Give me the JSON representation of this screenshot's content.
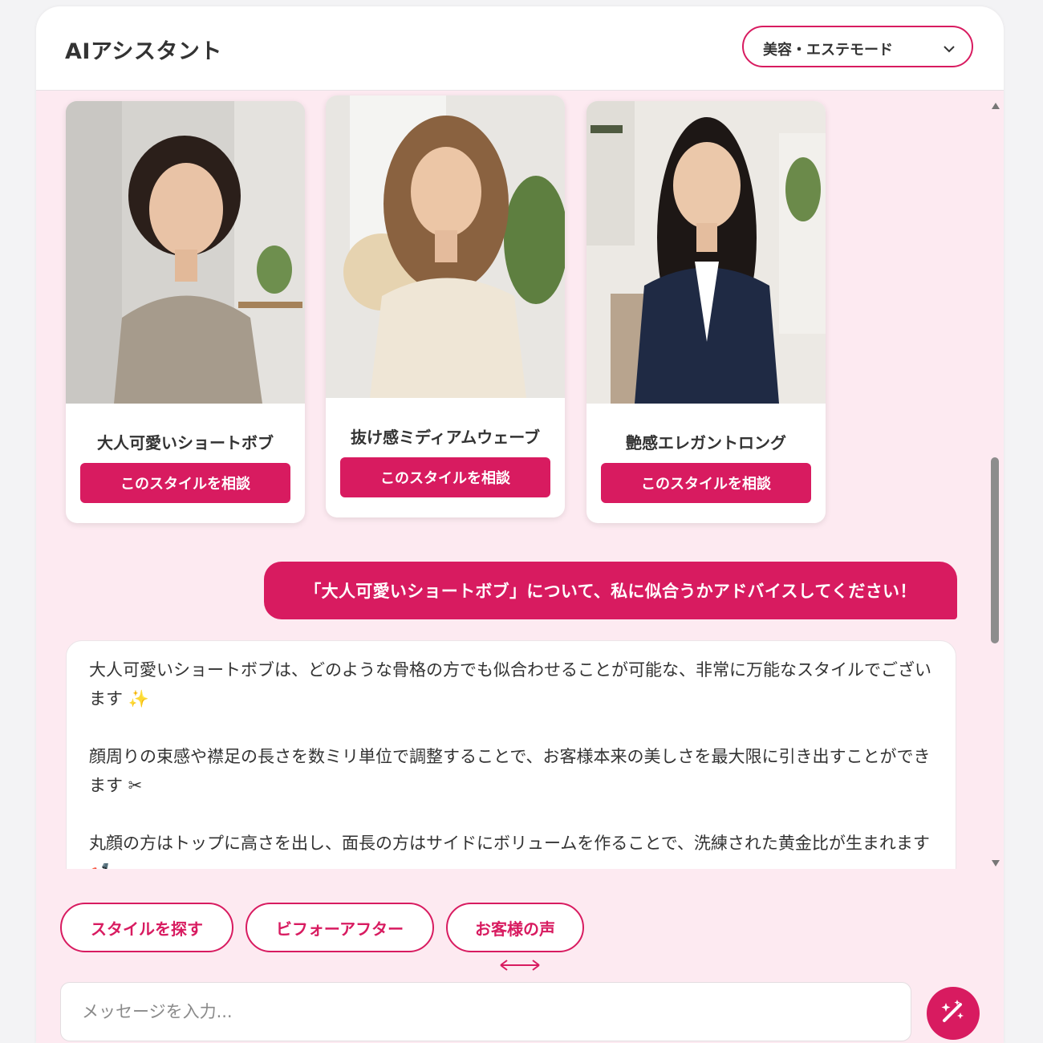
{
  "header": {
    "title": "AIアシスタント",
    "mode_select": {
      "value": "美容・エステモード"
    }
  },
  "style_cards": [
    {
      "name": "大人可愛いショートボブ",
      "button": "このスタイルを相談"
    },
    {
      "name": "抜け感ミディアムウェーブ",
      "button": "このスタイルを相談"
    },
    {
      "name": "艶感エレガントロング",
      "button": "このスタイルを相談"
    }
  ],
  "messages": {
    "user": "「大人可愛いショートボブ」について、私に似合うかアドバイスしてください！",
    "assistant": [
      "大人可愛いショートボブは、どのような骨格の方でも似合わせることが可能な、非常に万能なスタイルでございます ✨",
      "顔周りの束感や襟足の長さを数ミリ単位で調整することで、お客様本来の美しさを最大限に引き出すことができます ✂",
      "丸顔の方はトップに高さを出し、面長の方はサイドにボリュームを作ることで、洗練された黄金比が生まれます 💅"
    ]
  },
  "quick_replies": [
    "スタイルを探す",
    "ビフォーアフター",
    "お客様の声"
  ],
  "composer": {
    "placeholder": "メッセージを入力..."
  },
  "colors": {
    "accent": "#d81b60",
    "panel_bg": "#fdeaf1"
  }
}
